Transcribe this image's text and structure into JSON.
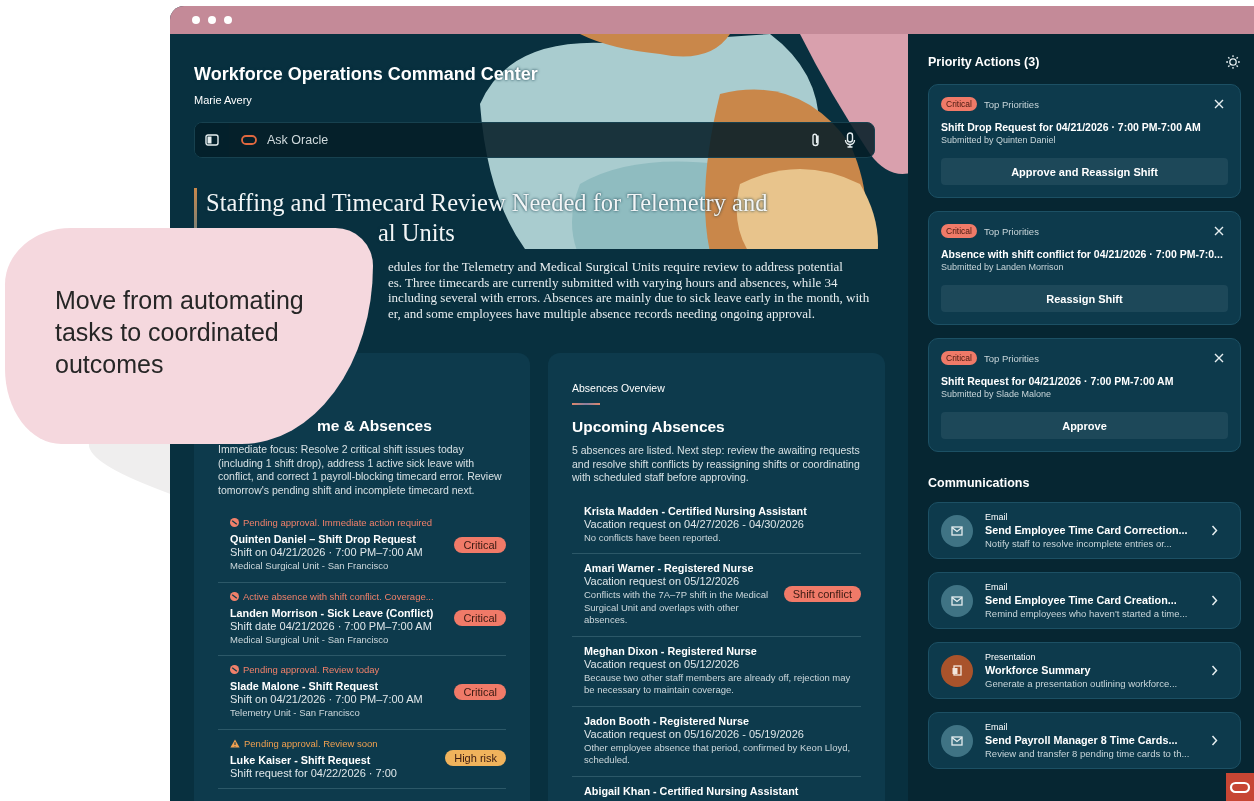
{
  "callout": {
    "text": "Move from automating tasks to coordinated outcomes"
  },
  "header": {
    "title": "Workforce Operations Command Center",
    "user": "Marie Avery"
  },
  "ask_bar": {
    "placeholder": "Ask Oracle"
  },
  "summary": {
    "heading_lines": [
      "Staffing and Timecard Review Needed for Telemetry and",
      "al Units"
    ],
    "body_lines": [
      "edules for the Telemetry and Medical Surgical Units require review to address potential",
      "es. Three timecards are currently submitted with varying hours and absences, while 34",
      "including several with errors. Absences are mainly due to sick leave early in the month, with",
      "er, and some employees have multiple absence records needing ongoing approval."
    ]
  },
  "cards": [
    {
      "heading": "me & Absences",
      "description": "Immediate focus: Resolve 2 critical shift issues today (including 1 shift drop), address 1 active sick leave with conflict, and correct 1 payroll-blocking timecard error. Review tomorrow's pending shift and incomplete timecard next.",
      "items": [
        {
          "status": {
            "kind": "error",
            "text": "Pending approval. Immediate action required"
          },
          "title": "Quinten Daniel – Shift Drop Request",
          "subtitle": "Shift on 04/21/2026 · 7:00 PM–7:00 AM",
          "note": "Medical Surgical Unit - San Francisco",
          "badge": {
            "kind": "critical",
            "label": "Critical"
          }
        },
        {
          "status": {
            "kind": "error",
            "text": "Active absence with shift conflict. Coverage..."
          },
          "title": "Landen Morrison - Sick Leave (Conflict)",
          "subtitle": "Shift date 04/21/2026 · 7:00 PM–7:00 AM",
          "note": "Medical Surgical Unit - San Francisco",
          "badge": {
            "kind": "critical",
            "label": "Critical"
          }
        },
        {
          "status": {
            "kind": "error",
            "text": "Pending approval. Review today"
          },
          "title": "Slade Malone - Shift Request",
          "subtitle": "Shift on 04/21/2026 · 7:00 PM–7:00 AM",
          "note": "Telemetry Unit - San Francisco",
          "badge": {
            "kind": "critical",
            "label": "Critical"
          }
        },
        {
          "status": {
            "kind": "warning",
            "text": "Pending approval. Review soon"
          },
          "title": "Luke Kaiser - Shift Request",
          "subtitle": "Shift request for 04/22/2026 · 7:00",
          "badge": {
            "kind": "high",
            "label": "High risk"
          }
        }
      ]
    },
    {
      "eyebrow": "Absences Overview",
      "heading": "Upcoming Absences",
      "description": "5 absences are listed. Next step: review the awaiting requests and resolve shift conflicts by reassigning shifts or coordinating with scheduled staff before approving.",
      "items": [
        {
          "title": "Krista Madden - Certified Nursing Assistant",
          "subtitle": "Vacation request on 04/27/2026 - 04/30/2026",
          "note": "No conflicts have been reported."
        },
        {
          "title": "Amari Warner - Registered Nurse",
          "subtitle": "Vacation request on 05/12/2026",
          "note": "Conflicts with the 7A–7P shift in the Medical Surgical Unit and overlaps with other absences.",
          "badge": {
            "kind": "critical",
            "label": "Shift conflict"
          }
        },
        {
          "title": "Meghan Dixon - Registered Nurse",
          "subtitle": "Vacation request on 05/12/2026",
          "note": "Because two other staff members are already off, rejection may be necessary to maintain coverage."
        },
        {
          "title": "Jadon Booth - Registered Nurse",
          "subtitle": "Vacation request on 05/16/2026 - 05/19/2026",
          "note": "Other employee absence that period, confirmed by Keon Lloyd, scheduled."
        },
        {
          "title": "Abigail Khan - Certified Nursing Assistant"
        }
      ]
    }
  ],
  "priority_actions": {
    "heading": "Priority Actions (3)",
    "items": [
      {
        "severity": "Critical",
        "category": "Top Priorities",
        "title": "Shift Drop Request for 04/21/2026 · 7:00 PM-7:00 AM",
        "submitted": "Submitted by Quinten Daniel",
        "action": "Approve and Reassign Shift"
      },
      {
        "severity": "Critical",
        "category": "Top Priorities",
        "title": "Absence with shift conflict for 04/21/2026 · 7:00 PM-7:0...",
        "submitted": "Submitted by Landen Morrison",
        "action": "Reassign Shift"
      },
      {
        "severity": "Critical",
        "category": "Top Priorities",
        "title": "Shift Request for 04/21/2026 · 7:00 PM-7:00 AM",
        "submitted": "Submitted by Slade Malone",
        "action": "Approve"
      }
    ]
  },
  "communications": {
    "heading": "Communications",
    "items": [
      {
        "kind": "email",
        "type": "Email",
        "title": "Send Employee Time Card Correction...",
        "description": "Notify staff to resolve incomplete entries or..."
      },
      {
        "kind": "email",
        "type": "Email",
        "title": "Send Employee Time Card Creation...",
        "description": "Remind employees who haven't started a time..."
      },
      {
        "kind": "presentation",
        "type": "Presentation",
        "title": "Workforce Summary",
        "description": "Generate a presentation outlining workforce..."
      },
      {
        "kind": "email",
        "type": "Email",
        "title": "Send Payroll Manager 8 Time Cards...",
        "description": "Review and transfer 8 pending time cards to th..."
      }
    ]
  }
}
